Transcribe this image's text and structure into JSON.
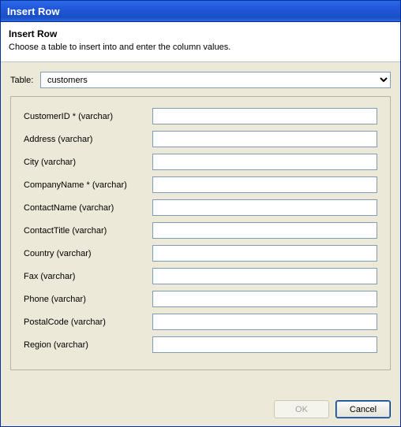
{
  "window": {
    "title": "Insert Row"
  },
  "header": {
    "heading": "Insert Row",
    "description": "Choose a table to insert into and enter the column values."
  },
  "tableSelector": {
    "label": "Table:",
    "selected": "customers"
  },
  "fields": [
    {
      "label": "CustomerID * (varchar)",
      "value": ""
    },
    {
      "label": "Address (varchar)",
      "value": ""
    },
    {
      "label": "City (varchar)",
      "value": ""
    },
    {
      "label": "CompanyName * (varchar)",
      "value": ""
    },
    {
      "label": "ContactName (varchar)",
      "value": ""
    },
    {
      "label": "ContactTitle (varchar)",
      "value": ""
    },
    {
      "label": "Country (varchar)",
      "value": ""
    },
    {
      "label": "Fax (varchar)",
      "value": ""
    },
    {
      "label": "Phone (varchar)",
      "value": ""
    },
    {
      "label": "PostalCode (varchar)",
      "value": ""
    },
    {
      "label": "Region (varchar)",
      "value": ""
    }
  ],
  "buttons": {
    "ok": "OK",
    "cancel": "Cancel"
  }
}
